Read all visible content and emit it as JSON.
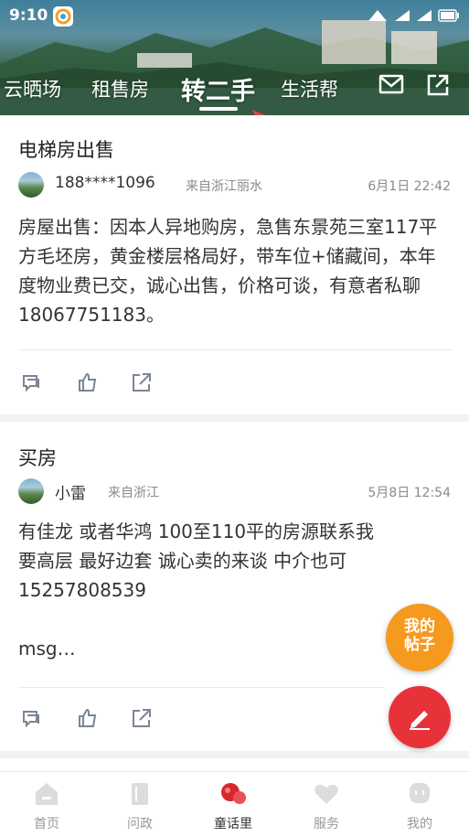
{
  "status_bar": {
    "time": "9:10"
  },
  "header": {
    "tabs": [
      {
        "label": "云晒场",
        "active": false
      },
      {
        "label": "租售房",
        "active": false
      },
      {
        "label": "转二手",
        "active": true
      },
      {
        "label": "生活帮",
        "active": false
      }
    ],
    "icons": [
      "mail-icon",
      "share-icon"
    ]
  },
  "posts": [
    {
      "title": "电梯房出售",
      "author": "188****1096",
      "source": "来自浙江丽水",
      "time": "6月1日 22:42",
      "body": "房屋出售：因本人异地购房，急售东景苑三室117平方毛坯房，黄金楼层格局好，带车位+储藏间，本年度物业费已交，诚心出售，价格可谈，有意者私聊18067751183。"
    },
    {
      "title": "买房",
      "author": "小雷",
      "source": "来自浙江",
      "time": "5月8日 12:54",
      "body_lines": [
        "有佳龙 或者华鸿 100至110平的房源联系我",
        "要高层 最好边套  诚心卖的来谈 中介也可",
        "15257808539",
        "",
        "msg…"
      ]
    }
  ],
  "fab": {
    "my_posts_line1": "我的",
    "my_posts_line2": "帖子"
  },
  "bottom_nav": [
    {
      "label": "首页",
      "icon": "home-icon"
    },
    {
      "label": "问政",
      "icon": "book-icon"
    },
    {
      "label": "童话里",
      "icon": "community-icon",
      "active": true
    },
    {
      "label": "服务",
      "icon": "heart-icon"
    },
    {
      "label": "我的",
      "icon": "profile-icon"
    }
  ],
  "colors": {
    "accent_red": "#e8323a",
    "fab_orange": "#f59a1f",
    "active_nav_icon": "#d9262e"
  }
}
